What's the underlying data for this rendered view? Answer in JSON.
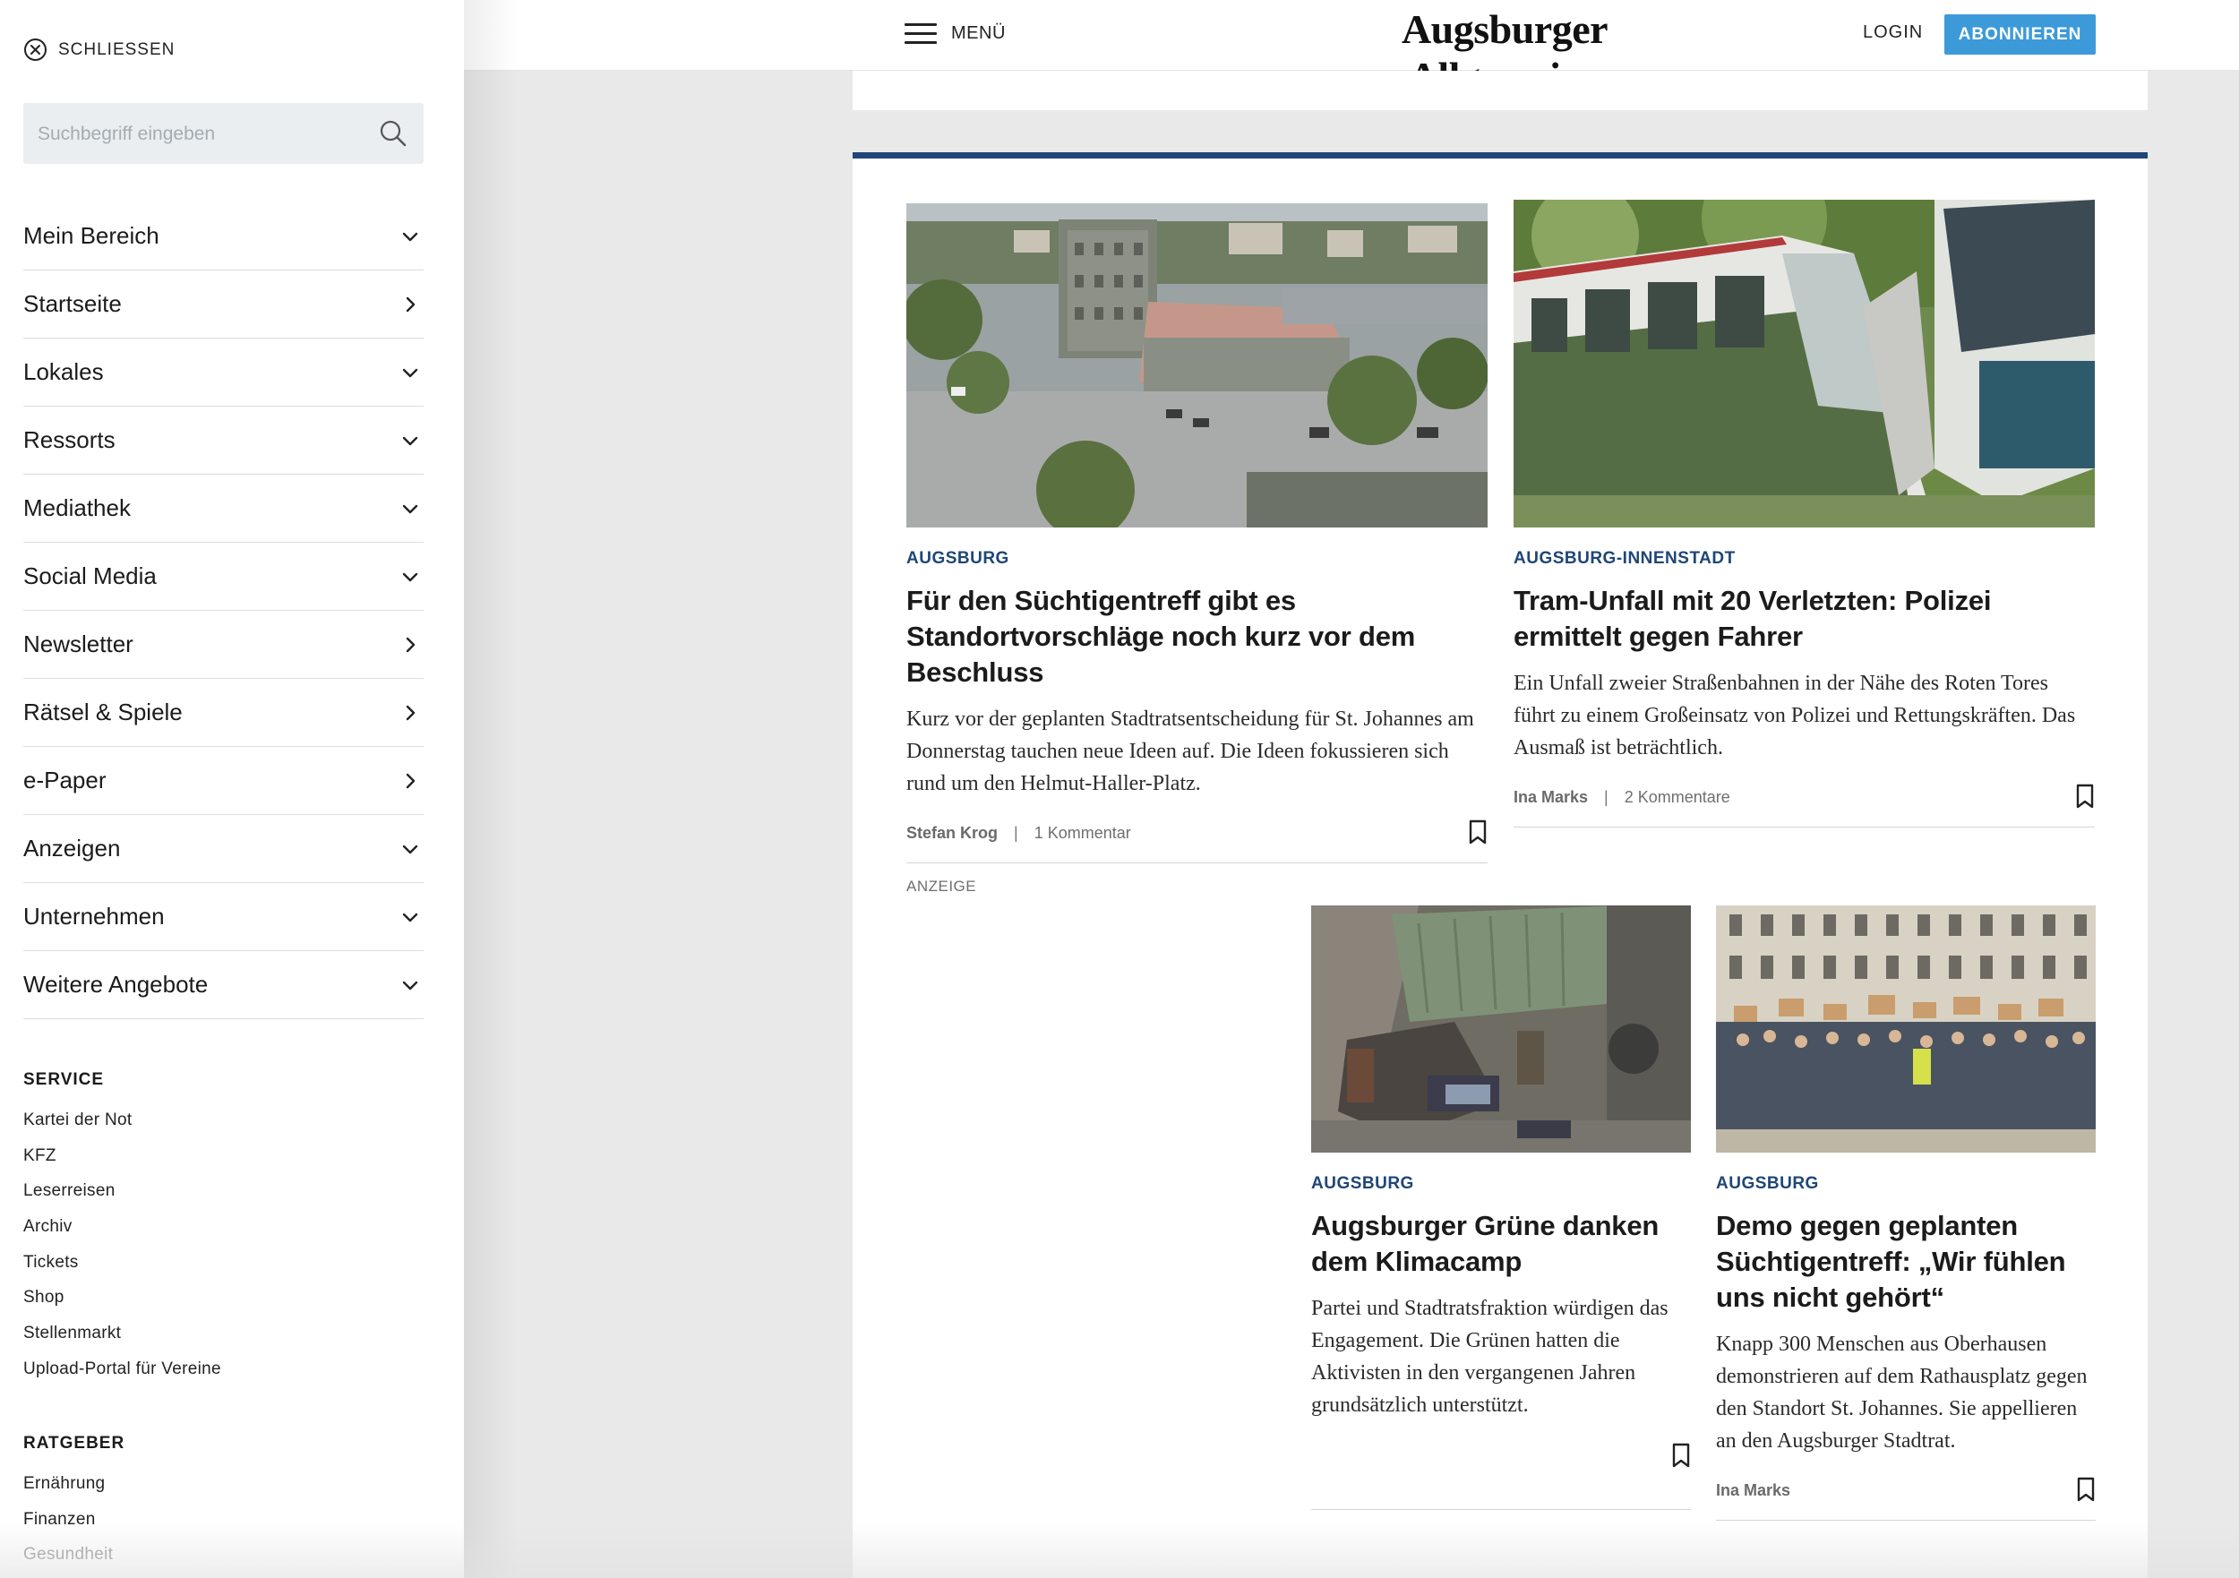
{
  "header": {
    "menu_label": "MENÜ",
    "brand": "Augsburger Allgemeine",
    "login": "LOGIN",
    "subscribe": "ABONNIEREN"
  },
  "sidebar": {
    "close_label": "SCHLIESSEN",
    "search_placeholder": "Suchbegriff eingeben",
    "nav": [
      {
        "label": "Mein Bereich",
        "icon": "chevron-down-icon"
      },
      {
        "label": "Startseite",
        "icon": "chevron-right-icon"
      },
      {
        "label": "Lokales",
        "icon": "chevron-down-icon"
      },
      {
        "label": "Ressorts",
        "icon": "chevron-down-icon"
      },
      {
        "label": "Mediathek",
        "icon": "chevron-down-icon"
      },
      {
        "label": "Social Media",
        "icon": "chevron-down-icon"
      },
      {
        "label": "Newsletter",
        "icon": "chevron-right-icon"
      },
      {
        "label": "Rätsel & Spiele",
        "icon": "chevron-right-icon"
      },
      {
        "label": "e-Paper",
        "icon": "chevron-right-icon"
      },
      {
        "label": "Anzeigen",
        "icon": "chevron-down-icon"
      },
      {
        "label": "Unternehmen",
        "icon": "chevron-down-icon"
      },
      {
        "label": "Weitere Angebote",
        "icon": "chevron-down-icon"
      }
    ],
    "service_title": "SERVICE",
    "service_links": [
      "Kartei der Not",
      "KFZ",
      "Leserreisen",
      "Archiv",
      "Tickets",
      "Shop",
      "Stellenmarkt",
      "Upload-Portal für Vereine"
    ],
    "ratgeber_title": "RATGEBER",
    "ratgeber_links": [
      "Ernährung",
      "Finanzen",
      "Gesundheit"
    ]
  },
  "main": {
    "ad_label": "ANZEIGE",
    "articles": [
      {
        "category": "AUGSBURG",
        "headline": "Für den Süchtigentreff gibt es Standortvorschläge noch kurz vor dem Beschluss",
        "teaser": "Kurz vor der geplanten Stadtratsentscheidung für St. Johannes am Donnerstag tauchen neue Ideen auf. Die Ideen fokussieren sich rund um den Helmut-Haller-Platz.",
        "author": "Stefan Krog",
        "comments": "1 Kommentar",
        "image": "train-station-aerial-photo"
      },
      {
        "category": "AUGSBURG-INNENSTADT",
        "headline": "Tram-Unfall mit 20 Verletzten: Polizei ermittelt gegen Fahrer",
        "teaser": "Ein Unfall zweier Straßenbahnen in der Nähe des Roten Tores führt zu einem Großeinsatz von Polizei und Rettungskräften. Das Ausmaß ist beträchtlich.",
        "author": "Ina Marks",
        "comments": "2 Kommentare",
        "image": "tram-crash-photo"
      },
      {
        "category": "AUGSBURG",
        "headline": "Augsburger Grüne danken dem Klimacamp",
        "teaser": "Partei und Stadtratsfraktion würdigen das Engagement. Die Grünen hatten die Aktivisten in den vergangenen Jahren grundsätzlich unterstützt.",
        "author": "",
        "comments": "",
        "image": "klimacamp-photo"
      },
      {
        "category": "AUGSBURG",
        "headline": "Demo gegen geplanten Süchtigentreff: „Wir fühlen uns nicht gehört“",
        "teaser": "Knapp 300 Menschen aus Oberhausen demonstrieren auf dem Rathausplatz gegen den Standort St. Johannes. Sie appellieren an den Augsburger Stadtrat.",
        "author": "Ina Marks",
        "comments": "",
        "image": "demonstration-photo"
      }
    ]
  },
  "colors": {
    "accent_blue": "#1f4677",
    "subscribe_blue": "#3d9ad9"
  }
}
